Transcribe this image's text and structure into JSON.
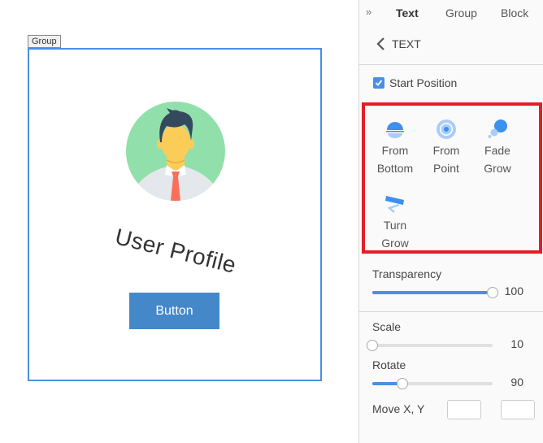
{
  "canvas": {
    "group_label": "Group",
    "title": "User Profile",
    "button_label": "Button",
    "avatar_icon": "user-avatar-icon"
  },
  "panel": {
    "collapse_icon": "»",
    "tabs": [
      {
        "label": "Text",
        "active": true
      },
      {
        "label": "Group",
        "active": false
      },
      {
        "label": "Block",
        "active": false
      }
    ],
    "back_label": "TEXT",
    "start_position": {
      "label": "Start Position",
      "checked": true
    },
    "animations": [
      {
        "line1": "From",
        "line2": "Bottom",
        "icon": "from-bottom-icon"
      },
      {
        "line1": "From",
        "line2": "Point",
        "icon": "from-point-icon"
      },
      {
        "line1": "Fade",
        "line2": "Grow",
        "icon": "fade-grow-icon"
      },
      {
        "line1": "Turn",
        "line2": "Grow",
        "icon": "turn-grow-icon"
      }
    ],
    "transparency": {
      "label": "Transparency",
      "value": "100",
      "fraction": 1.0
    },
    "scale": {
      "label": "Scale",
      "value": "10",
      "fraction": 0.0
    },
    "rotate": {
      "label": "Rotate",
      "value": "90",
      "fraction": 0.25
    },
    "move": {
      "label": "Move X, Y",
      "x_value": "",
      "y_value": ""
    }
  },
  "colors": {
    "accent": "#4a90e2",
    "highlight": "#e41e26",
    "button": "#4588c9"
  }
}
